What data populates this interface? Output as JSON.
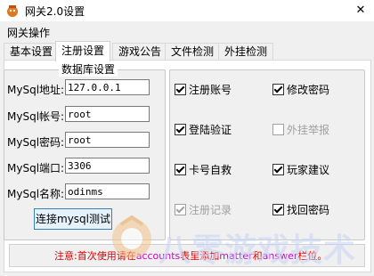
{
  "window": {
    "title": "网关2.0设置",
    "close_glyph": "✕"
  },
  "menu": {
    "label": "网关操作"
  },
  "tabs": [
    {
      "label": "基本设置"
    },
    {
      "label": "注册设置"
    },
    {
      "label": "游戏公告"
    },
    {
      "label": "文件检测"
    },
    {
      "label": "外挂检测"
    }
  ],
  "db_group": {
    "title": "数据库设置",
    "fields": [
      {
        "label": "MySql地址:",
        "value": "127.0.0.1"
      },
      {
        "label": "MySql帐号:",
        "value": "root"
      },
      {
        "label": "MySql密码:",
        "value": "root"
      },
      {
        "label": "MySql端口:",
        "value": "3306"
      },
      {
        "label": "MySql名称:",
        "value": "odinms"
      }
    ],
    "test_button": "连接mysql测试"
  },
  "options": [
    {
      "label": "注册账号",
      "checked": true,
      "enabled": true
    },
    {
      "label": "修改密码",
      "checked": true,
      "enabled": true
    },
    {
      "label": "登陆验证",
      "checked": true,
      "enabled": true
    },
    {
      "label": "外挂举报",
      "checked": false,
      "enabled": false
    },
    {
      "label": "卡号自救",
      "checked": true,
      "enabled": true
    },
    {
      "label": "玩家建议",
      "checked": true,
      "enabled": true
    },
    {
      "label": "注册记录",
      "checked": true,
      "enabled": false
    },
    {
      "label": "找回密码",
      "checked": true,
      "enabled": true
    }
  ],
  "notice": {
    "prefix": "注意:首次使用请在",
    "accounts": "accounts",
    "mid": "表里添加",
    "matter": "matter",
    "and": "和",
    "answer": "answer",
    "suffix": "栏位。"
  },
  "watermark": {
    "text": "八零游戏技术"
  },
  "colors": {
    "notice_red": "#e00000",
    "notice_magenta": "#d000d0",
    "focus_blue": "#3c7fb1"
  }
}
